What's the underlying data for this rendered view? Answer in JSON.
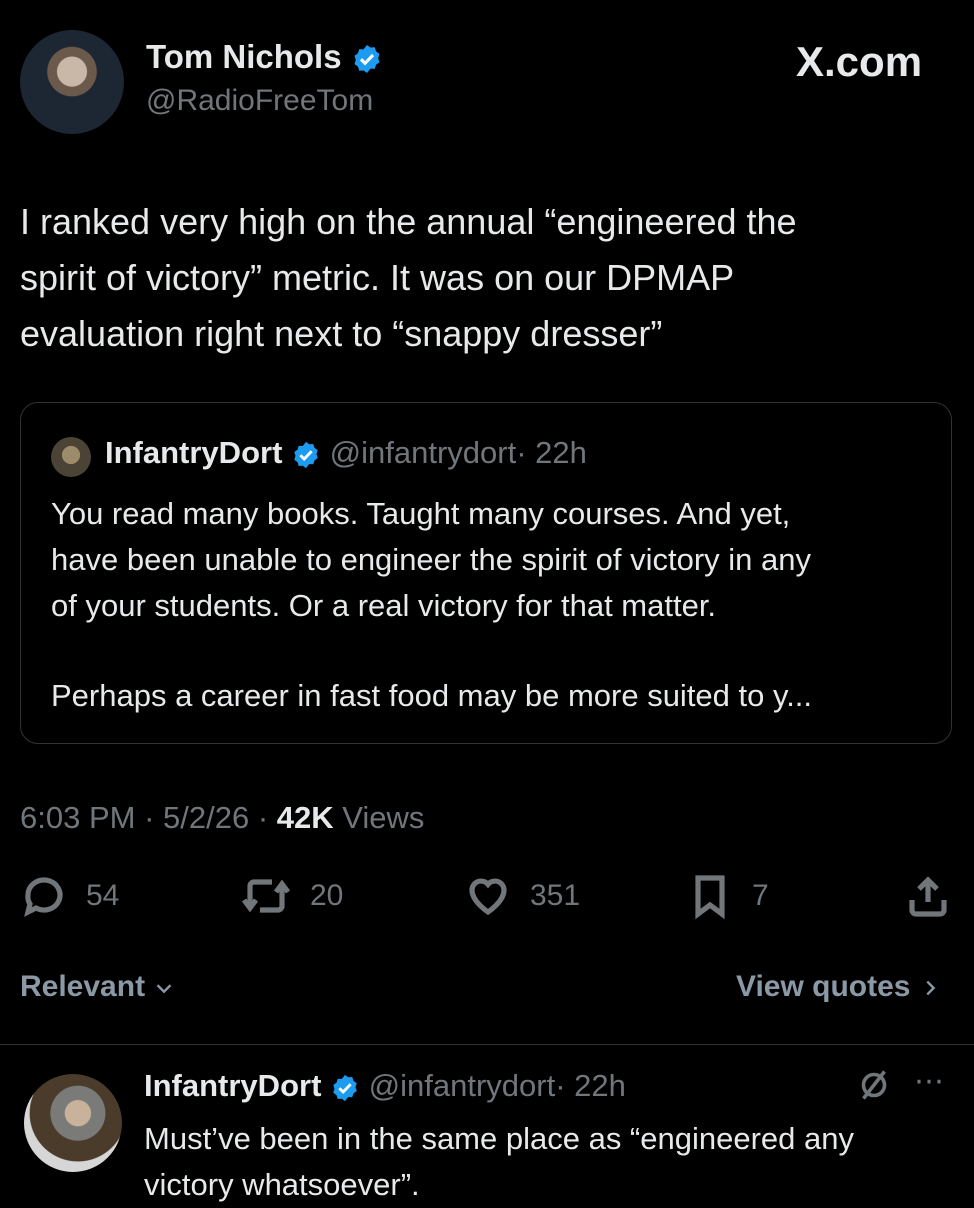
{
  "header": {
    "name": "Tom Nichols",
    "handle": "@RadioFreeTom",
    "watermark": "X.com"
  },
  "tweet": {
    "text_lines": [
      "I ranked very high on the annual “engineered the",
      "spirit of victory” metric. It was on our DPMAP",
      "evaluation right next to “snappy dresser”"
    ]
  },
  "quote": {
    "name": "InfantryDort",
    "handle": "@infantrydort",
    "time": "· 22h",
    "lines": [
      "You read many books. Taught many courses. And yet,",
      "have been unable to engineer the spirit of victory in any",
      "of your students. Or a real victory for that matter."
    ],
    "last_line": "Perhaps a career in fast food may be more suited to y..."
  },
  "meta": {
    "time": "6:03 PM",
    "date": "· 5/2/26 ·",
    "views_count": "42K",
    "views_label": "Views"
  },
  "actions": {
    "replies": "54",
    "retweets": "20",
    "likes": "351",
    "bookmarks": "7"
  },
  "sort": {
    "label": "Relevant",
    "view_quotes": "View quotes"
  },
  "reply": {
    "name": "InfantryDort",
    "handle": "@infantrydort",
    "time": "· 22h",
    "lines": [
      "Must’ve been in the same place as “engineered any",
      "victory whatsoever”."
    ]
  },
  "colors": {
    "background": "#000000",
    "text": "#e7e9ea",
    "muted": "#71767b",
    "verified": "#1d9bf0",
    "border": "#2f3336"
  }
}
